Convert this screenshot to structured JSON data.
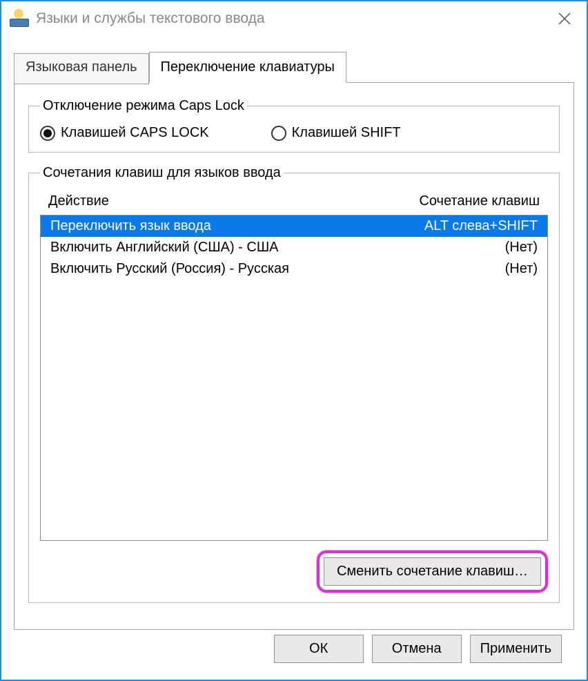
{
  "window": {
    "title": "Языки и службы текстового ввода"
  },
  "tabs": {
    "lang_panel": "Языковая панель",
    "kbd_switch": "Переключение клавиатуры"
  },
  "capslock": {
    "legend": "Отключение режима Caps Lock",
    "opt_caps": "Клавишей CAPS LOCK",
    "opt_shift": "Клавишей SHIFT"
  },
  "hotkeys": {
    "legend": "Сочетания клавиш для языков ввода",
    "col_action": "Действие",
    "col_combo": "Сочетание клавиш",
    "rows": [
      {
        "action": "Переключить язык ввода",
        "combo": "ALT слева+SHIFT",
        "selected": true
      },
      {
        "action": "Включить Английский (США) - США",
        "combo": "(Нет)",
        "selected": false
      },
      {
        "action": "Включить Русский (Россия) - Русская",
        "combo": "(Нет)",
        "selected": false
      }
    ],
    "change_btn": "Сменить сочетание клавиш…"
  },
  "footer": {
    "ok": "ОК",
    "cancel": "Отмена",
    "apply": "Применить"
  }
}
